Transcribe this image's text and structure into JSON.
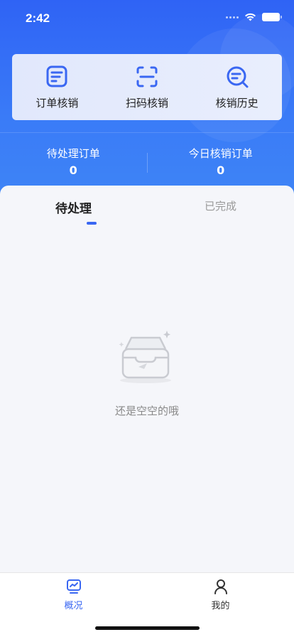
{
  "status_bar": {
    "time": "2:42"
  },
  "quick_actions": [
    {
      "label": "订单核销",
      "icon": "order-icon"
    },
    {
      "label": "扫码核销",
      "icon": "scan-icon"
    },
    {
      "label": "核销历史",
      "icon": "history-icon"
    }
  ],
  "stats": {
    "pending": {
      "label": "待处理订单",
      "value": "0"
    },
    "today": {
      "label": "今日核销订单",
      "value": "0"
    }
  },
  "tabs": [
    {
      "label": "待处理",
      "active": true
    },
    {
      "label": "已完成",
      "active": false
    }
  ],
  "empty_state": {
    "text": "还是空空的哦",
    "icon": "empty-inbox-icon"
  },
  "tabbar": [
    {
      "label": "概况",
      "icon": "overview-icon",
      "active": true
    },
    {
      "label": "我的",
      "icon": "profile-icon",
      "active": false
    }
  ],
  "colors": {
    "primary": "#3a67f2",
    "hero_gradient_start": "#2f63f5",
    "hero_gradient_end": "#3f86f6"
  }
}
